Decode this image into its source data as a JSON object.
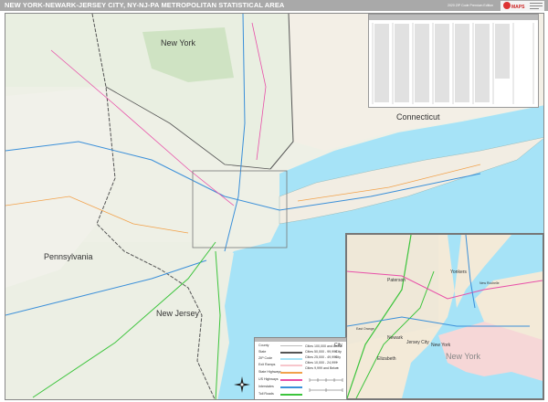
{
  "header": {
    "title": "NEW YORK-NEWARK-JERSEY CITY, NY-NJ-PA METROPOLITAN STATISTICAL AREA",
    "edition": "2020 ZIP Code Premium Edition",
    "logo_text": "Market MAPS"
  },
  "map": {
    "labels": {
      "new_york_state": "New York",
      "connecticut": "Connecticut",
      "pennsylvania": "Pennsylvania",
      "new_jersey": "New Jersey"
    },
    "colors": {
      "water": "#a6e3f7",
      "land": "#eef0e6",
      "border": "#555555",
      "interstate": "#3a8fd9",
      "us_highway": "#e84fa8",
      "toll_road": "#3cc43c",
      "state_highway": "#f2a14a"
    }
  },
  "inset": {
    "labels": {
      "paterson": "Paterson",
      "yonkers": "Yonkers",
      "new_rochelle": "New Rochelle",
      "east_orange": "East Orange",
      "newark": "Newark",
      "jersey_city": "Jersey City",
      "new_york_city": "New York",
      "elizabeth": "Elizabeth",
      "new_york_borough": "New York"
    }
  },
  "legend": {
    "items": [
      "County",
      "State",
      "ZIP Code",
      "Exit Ramps",
      "State Highways",
      "US Highways",
      "Interstates",
      "Toll Roads"
    ],
    "cities": [
      "Cities 100,000 and Above",
      "Cities 50,000 - 99,999",
      "Cities 25,000 - 49,999",
      "Cities 10,000 - 24,999",
      "Cities 9,999 and Below"
    ],
    "city_samples": [
      "City",
      "City",
      "City",
      "+",
      "+"
    ]
  }
}
